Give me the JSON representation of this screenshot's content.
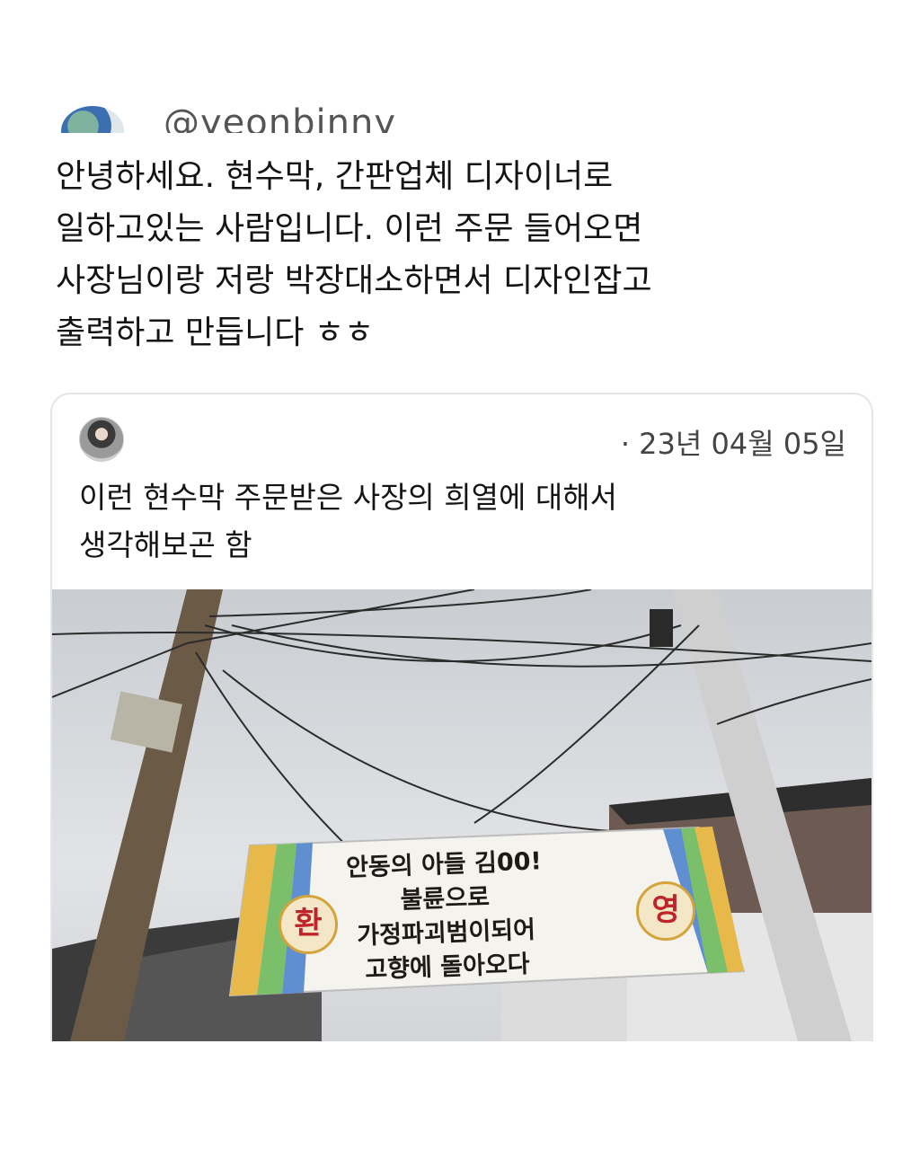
{
  "tweet": {
    "handle": "@yeonbinny",
    "text": "안녕하세요. 현수막, 간판업체 디자이너로\n일하고있는 사람입니다. 이런 주문 들어오면\n사장님이랑 저랑 박장대소하면서 디자인잡고\n출력하고 만듭니다 ㅎㅎ"
  },
  "quoted_tweet": {
    "date": "· 23년 04월 05일",
    "text": "이런 현수막 주문받은 사장의 희열에 대해서\n생각해보곤 함"
  },
  "banner": {
    "left_char": "환",
    "right_char": "영",
    "text": "안동의 아들 김00!\n불륜으로\n가정파괴범이되어\n고향에 돌아오다"
  },
  "colors": {
    "text": "#141414",
    "secondary_text": "#444444",
    "card_border": "#e3e6ea",
    "background": "#ffffff"
  }
}
